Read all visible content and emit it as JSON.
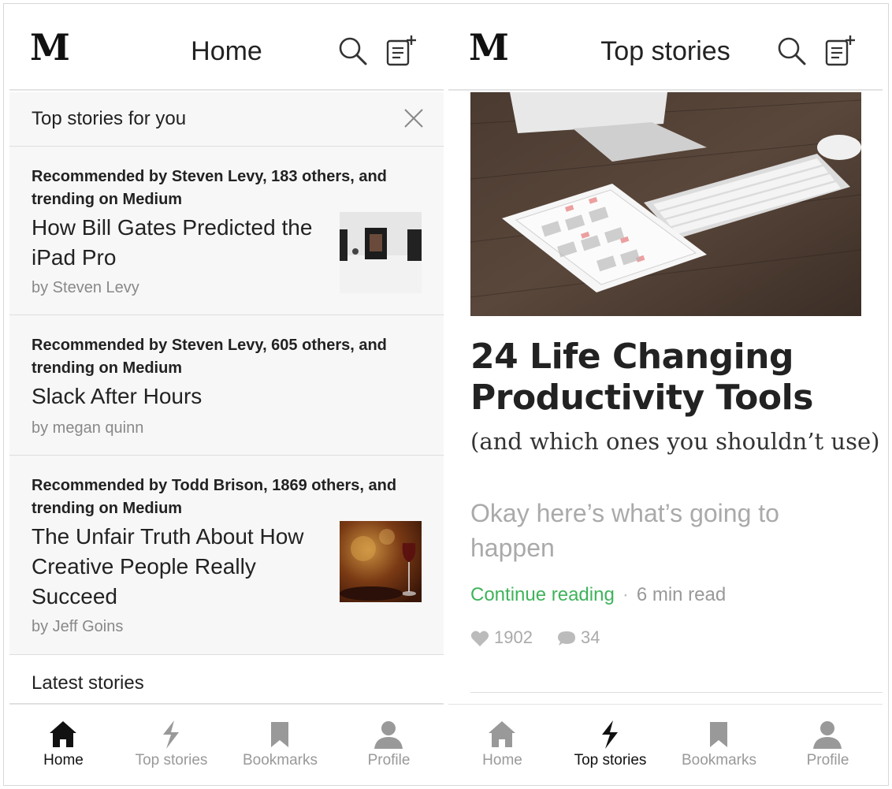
{
  "screens": [
    {
      "header": {
        "logo": "M",
        "title": "Home"
      },
      "banner": {
        "text": "Top stories for you"
      },
      "stories": [
        {
          "recommendation": "Recommended by Steven Levy, 183 others, and trending on Medium",
          "title": "How Bill Gates Predicted the iPad Pro",
          "author": "by Steven Levy",
          "has_thumbnail": true
        },
        {
          "recommendation": "Recommended by Steven Levy, 605 others, and trending on Medium",
          "title": "Slack After Hours",
          "author": "by megan quinn",
          "has_thumbnail": false
        },
        {
          "recommendation": "Recommended by Todd Brison, 1869 others, and trending on Medium",
          "title": "The Unfair Truth About How Creative People Really Succeed",
          "author": "by Jeff Goins",
          "has_thumbnail": true
        }
      ],
      "section": "Latest stories",
      "tabs": [
        {
          "label": "Home",
          "icon": "home-icon",
          "active": true
        },
        {
          "label": "Top stories",
          "icon": "bolt-icon",
          "active": false
        },
        {
          "label": "Bookmarks",
          "icon": "bookmark-icon",
          "active": false
        },
        {
          "label": "Profile",
          "icon": "profile-icon",
          "active": false
        }
      ]
    },
    {
      "header": {
        "logo": "M",
        "title": "Top stories"
      },
      "article": {
        "title": "24 Life Changing Productivity Tools",
        "subtitle": "(and which ones you shouldn’t use)",
        "lead": "Okay here’s what’s going to happen",
        "continue_label": "Continue reading",
        "separator": "·",
        "read_time": "6 min read",
        "likes": "1902",
        "responses": "34"
      },
      "tabs": [
        {
          "label": "Home",
          "icon": "home-icon",
          "active": false
        },
        {
          "label": "Top stories",
          "icon": "bolt-icon",
          "active": true
        },
        {
          "label": "Bookmarks",
          "icon": "bookmark-icon",
          "active": false
        },
        {
          "label": "Profile",
          "icon": "profile-icon",
          "active": false
        }
      ]
    }
  ],
  "colors": {
    "accent_green": "#3fb35b",
    "muted_text": "#999999",
    "panel_bg": "#f7f7f7"
  }
}
